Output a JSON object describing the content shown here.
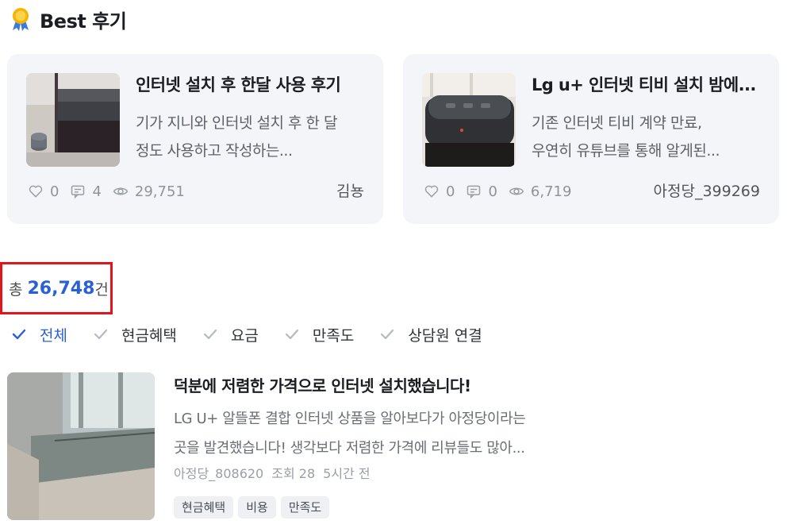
{
  "best_section": {
    "title": "Best 후기",
    "icon": "medal-icon",
    "cards": [
      {
        "title": "인터넷 설치 후 한달 사용 후기",
        "excerpt_line1": "기가 지니와 인터넷 설치 후 한 달",
        "excerpt_line2": "정도 사용하고 작성하는...",
        "likes": "0",
        "comments": "4",
        "views": "29,751",
        "author": "김뇽"
      },
      {
        "title": "Lg u+ 인터넷 티비 설치 밤에...",
        "excerpt_line1": "기존 인터넷 티비 계약 만료,",
        "excerpt_line2": "우연히 유튜브를 통해 알게된...",
        "likes": "0",
        "comments": "0",
        "views": "6,719",
        "author": "아정당_399269"
      }
    ]
  },
  "total": {
    "prefix": "총",
    "count": "26,748",
    "suffix": "건"
  },
  "filters": [
    {
      "label": "전체",
      "active": true
    },
    {
      "label": "현금혜택",
      "active": false
    },
    {
      "label": "요금",
      "active": false
    },
    {
      "label": "만족도",
      "active": false
    },
    {
      "label": "상담원 연결",
      "active": false
    }
  ],
  "post": {
    "title": "덕분에 저렴한 가격으로 인터넷 설치했습니다!",
    "excerpt_line1": "LG U+ 알뜰폰 결합 인터넷 상품을 알아보다가 아정당이라는",
    "excerpt_line2": "곳을 발견했습니다! 생각보다 저렴한 가격에 리뷰들도 많아...",
    "author": "아정당_808620",
    "views": "조회 28",
    "time": "5시간 전",
    "tags": [
      "현금혜택",
      "비용",
      "만족도"
    ]
  },
  "colors": {
    "accent": "#2a5fd6",
    "highlight_border": "#e3141b",
    "card_bg": "#f4f5f8"
  }
}
